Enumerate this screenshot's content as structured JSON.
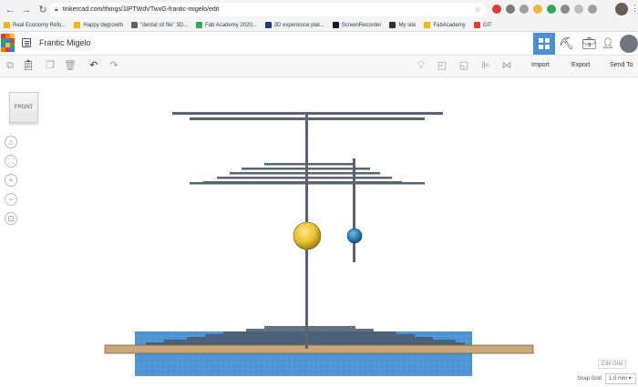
{
  "browser": {
    "url": "tinkercad.com/things/1IPTWdVTwxG-frantic-migelo/edit",
    "bookmarks": [
      {
        "label": "Real Economy Refo...",
        "color": "#f4b400"
      },
      {
        "label": "Happy degrowth",
        "color": "#f4b400"
      },
      {
        "label": "\"dental stl file\" 3D...",
        "color": "#5f6368"
      },
      {
        "label": "Fab Academy 2020...",
        "color": "#34a853"
      },
      {
        "label": "3D experience plat...",
        "color": "#1a3d7c"
      },
      {
        "label": "ScreenRecorder",
        "color": "#1a1a2e"
      },
      {
        "label": "My site",
        "color": "#333333"
      },
      {
        "label": "FabAcademy",
        "color": "#f4b400"
      },
      {
        "label": "GIT",
        "color": "#e24329"
      }
    ]
  },
  "header": {
    "logo_text": "TINKERCAD",
    "title": "Frantic Migelo"
  },
  "toolbar": {
    "import_label": "Import",
    "export_label": "Export",
    "send_to_label": "Send To"
  },
  "canvas": {
    "viewcube_label": "FRONT",
    "edit_grid_label": "Edit Grid",
    "snap_grid_label": "Snap Grid",
    "snap_grid_value": "1.0 mm ▾"
  },
  "colors": {
    "workplane": "#4a93d4",
    "base_plank": "#c9a77a",
    "rods": "#5a6470",
    "gold_sphere": "#e8c130",
    "blue_sphere": "#2f7fb5",
    "view_active": "#4a90d9"
  },
  "icons": {
    "back": "arrow-left-icon",
    "forward": "arrow-right-icon",
    "reload": "reload-icon",
    "home": "home-icon",
    "fit": "fit-view-icon",
    "zoom_in": "zoom-in-icon",
    "zoom_out": "zoom-out-icon",
    "perspective": "perspective-icon"
  }
}
